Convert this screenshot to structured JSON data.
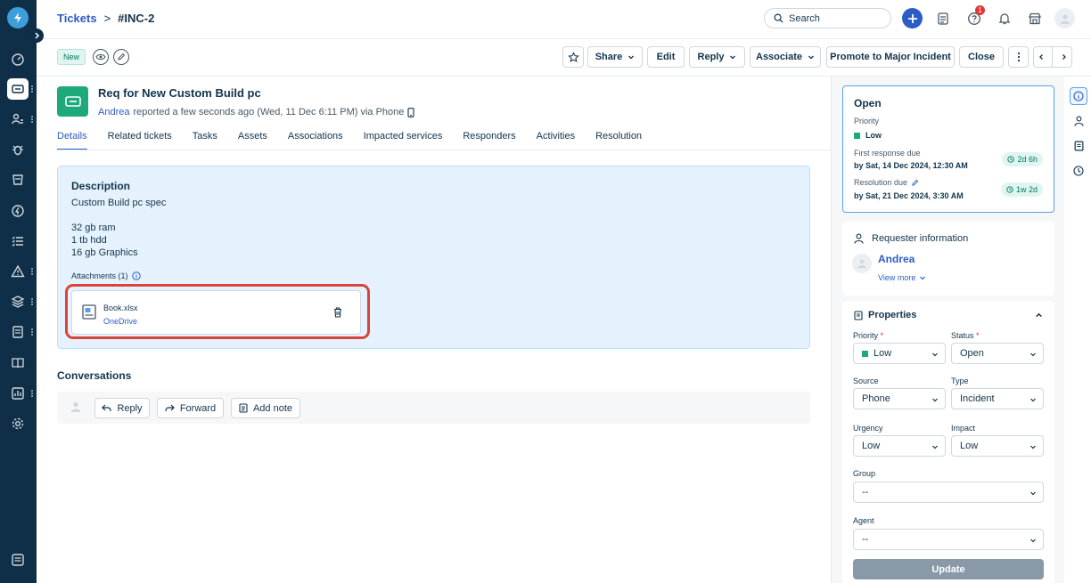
{
  "breadcrumb": {
    "parent": "Tickets",
    "separator": ">",
    "current": "#INC-2"
  },
  "header": {
    "search_placeholder": "Search",
    "notification_count": "1"
  },
  "toolbar": {
    "status_tag": "New",
    "share_label": "Share",
    "edit_label": "Edit",
    "reply_label": "Reply",
    "associate_label": "Associate",
    "promote_label": "Promote to Major Incident",
    "close_label": "Close"
  },
  "ticket": {
    "title": "Req for New Custom Build pc",
    "requester": "Andrea",
    "meta": "reported a few seconds ago (Wed, 11 Dec 6:11 PM) via Phone"
  },
  "tabs": [
    "Details",
    "Related tickets",
    "Tasks",
    "Assets",
    "Associations",
    "Impacted services",
    "Responders",
    "Activities",
    "Resolution"
  ],
  "description": {
    "heading": "Description",
    "lines": [
      "Custom Build pc spec",
      "32 gb ram",
      "1 tb hdd",
      "16 gb Graphics"
    ],
    "attachments_label": "Attachments (1)",
    "file_name": "Book.xlsx",
    "file_source": "OneDrive"
  },
  "conversations": {
    "heading": "Conversations",
    "reply_label": "Reply",
    "forward_label": "Forward",
    "add_note_label": "Add note"
  },
  "status_card": {
    "status": "Open",
    "priority_label": "Priority",
    "priority_value": "Low",
    "first_response_label": "First response due",
    "first_response_value": "by Sat, 14 Dec 2024, 12:30 AM",
    "first_response_pill": "2d 6h",
    "resolution_label": "Resolution due",
    "resolution_value": "by Sat, 21 Dec 2024, 3:30 AM",
    "resolution_pill": "1w 2d"
  },
  "requester_card": {
    "heading": "Requester information",
    "name": "Andrea",
    "view_more": "View more"
  },
  "properties": {
    "heading": "Properties",
    "priority_label": "Priority",
    "priority_value": "Low",
    "status_label": "Status",
    "status_value": "Open",
    "source_label": "Source",
    "source_value": "Phone",
    "type_label": "Type",
    "type_value": "Incident",
    "urgency_label": "Urgency",
    "urgency_value": "Low",
    "impact_label": "Impact",
    "impact_value": "Low",
    "group_label": "Group",
    "group_value": "--",
    "agent_label": "Agent",
    "agent_value": "--",
    "required_mark": "*",
    "update_label": "Update"
  },
  "colors": {
    "accent": "#2c5cc5",
    "rail": "#0e2f47",
    "success": "#1ea97c",
    "highlight": "#d9443a"
  }
}
